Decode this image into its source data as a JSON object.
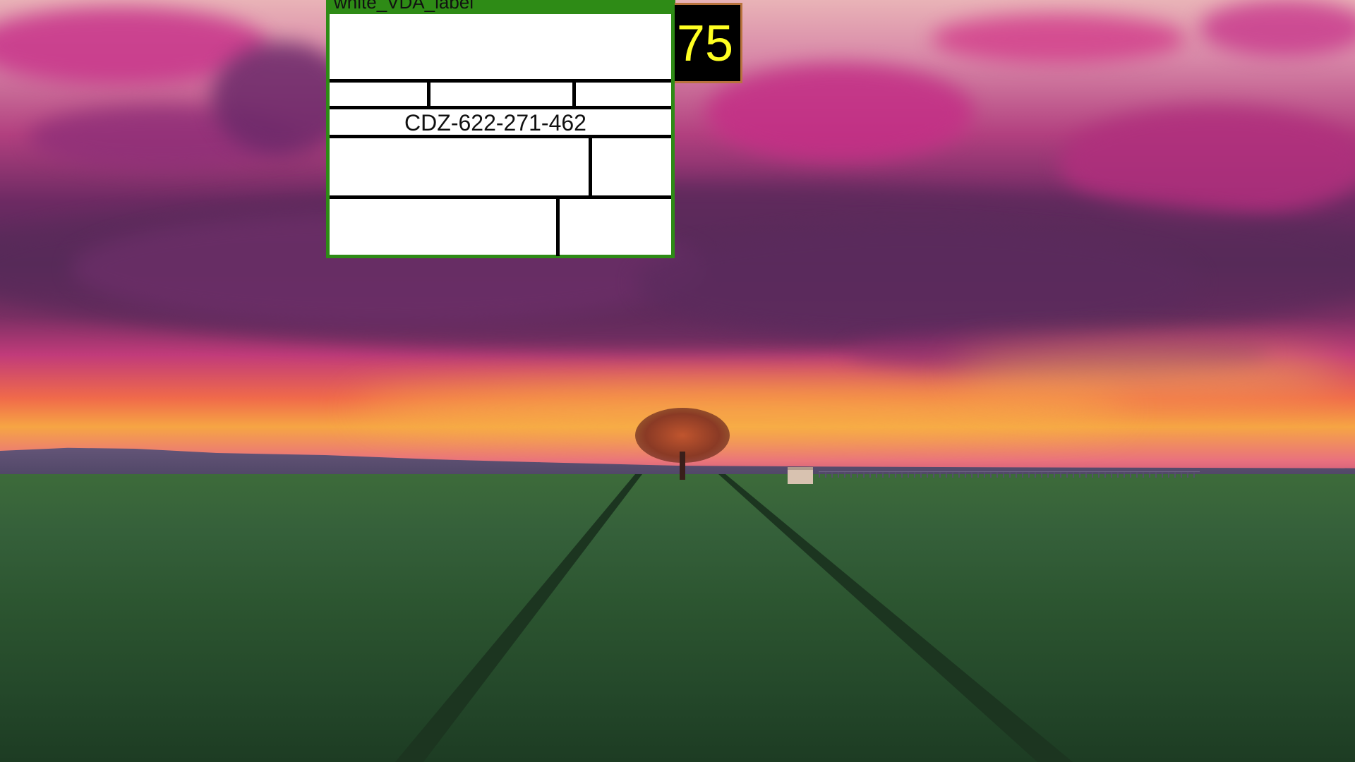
{
  "background": {
    "scene": "sunset-field-wallpaper",
    "colors": {
      "sky_top": "#e9b3b7",
      "clouds": "#c2327f",
      "horizon_glow": "#f6a544",
      "field": "#2c5530"
    }
  },
  "label": {
    "header_text": "white_VDA_label",
    "code": "CDZ-622-271-462",
    "header_color": "#2e8b16"
  },
  "counter": {
    "value": "75",
    "text_color": "#ffff22"
  }
}
